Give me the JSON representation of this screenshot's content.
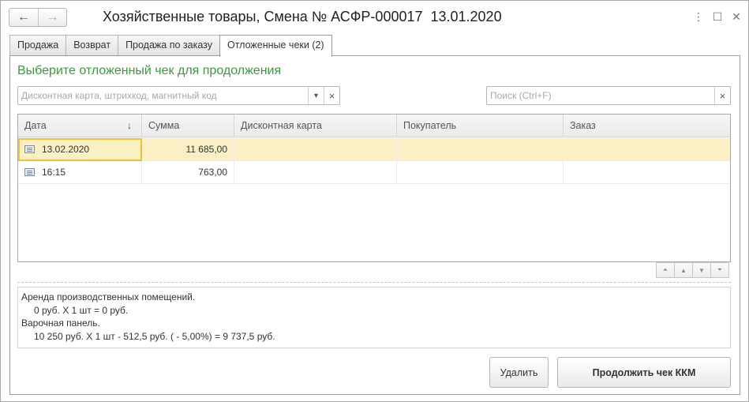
{
  "window": {
    "title": "Хозяйственные товары, Смена № АСФР-000017  13.01.2020",
    "nav_back": "←",
    "nav_forward": "→",
    "more": "⋮",
    "maximize": "☐",
    "close": "✕"
  },
  "tabs": [
    {
      "label": "Продажа"
    },
    {
      "label": "Возврат"
    },
    {
      "label": "Продажа по заказу"
    },
    {
      "label": "Отложенные чеки (2)"
    }
  ],
  "heading": "Выберите отложенный чек для продолжения",
  "discount_field": {
    "value": "",
    "placeholder": "Дисконтная карта, штрихкод, магнитный код",
    "dropdown": "▾",
    "clear": "×"
  },
  "search_field": {
    "value": "",
    "placeholder": "Поиск (Ctrl+F)",
    "clear": "×"
  },
  "table": {
    "columns": [
      "Дата",
      "Сумма",
      "Дисконтная карта",
      "Покупатель",
      "Заказ"
    ],
    "sort_indicator": "↓",
    "rows": [
      {
        "date": "13.02.2020",
        "sum": "11 685,00",
        "card": "",
        "buyer": "",
        "order": ""
      },
      {
        "date": "16:15",
        "sum": "763,00",
        "card": "",
        "buyer": "",
        "order": ""
      }
    ]
  },
  "scroll_buttons": [
    "⏶",
    "▲",
    "▼",
    "⏷"
  ],
  "details": {
    "lines": [
      "Аренда производственных помещений.",
      "0 руб. X 1 шт = 0 руб.",
      "Варочная панель.",
      "10 250 руб. X 1 шт - 512,5 руб. ( - 5,00%) = 9 737,5 руб."
    ]
  },
  "buttons": {
    "delete": "Удалить",
    "continue": "Продолжить чек ККМ"
  }
}
